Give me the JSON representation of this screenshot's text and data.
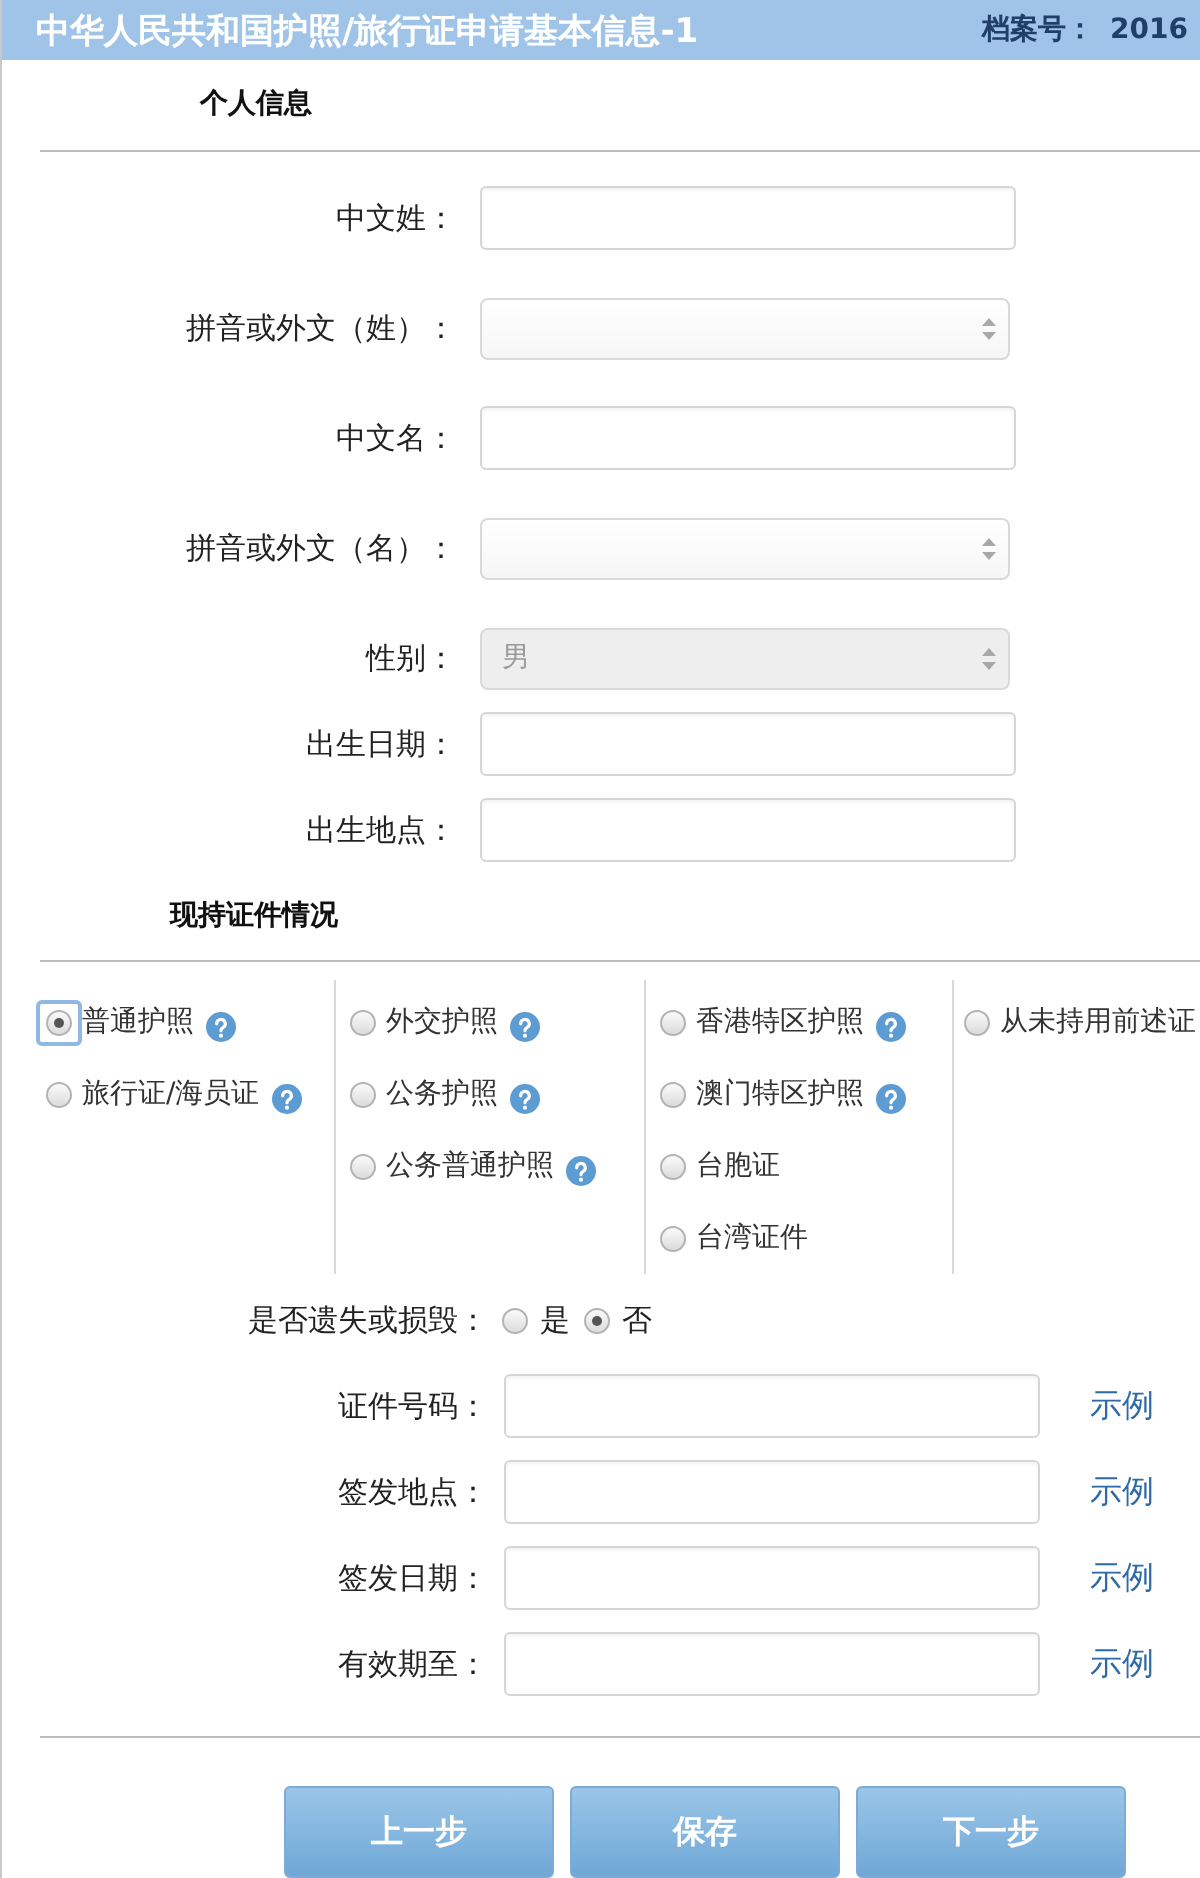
{
  "header": {
    "title": "中华人民共和国护照/旅行证申请基本信息-1",
    "file_number_label": "档案号：",
    "file_number": "2016"
  },
  "personal_info": {
    "heading": "个人信息",
    "fields": [
      {
        "kind": "input",
        "label": "中文姓：",
        "disabled": false
      },
      {
        "kind": "select",
        "label": "拼音或外文（姓）：",
        "disabled": false
      },
      {
        "kind": "input",
        "label": "中文名：",
        "disabled": false
      },
      {
        "kind": "select",
        "label": "拼音或外文（名）：",
        "disabled": false
      },
      {
        "kind": "select",
        "label": "性别：",
        "value": "男",
        "disabled": true
      },
      {
        "kind": "input",
        "label": "出生日期：",
        "disabled": false
      },
      {
        "kind": "input",
        "label": "出生地点：",
        "disabled": false
      }
    ]
  },
  "current_documents": {
    "heading": "现持证件情况",
    "columns": [
      {
        "options": [
          {
            "label": "普通护照",
            "selected": true,
            "focused": true,
            "help": true
          },
          {
            "label": "旅行证/海员证",
            "selected": false,
            "focused": false,
            "help": true
          }
        ]
      },
      {
        "options": [
          {
            "label": "外交护照",
            "selected": false,
            "focused": false,
            "help": true
          },
          {
            "label": "公务护照",
            "selected": false,
            "focused": false,
            "help": true
          },
          {
            "label": "公务普通护照",
            "selected": false,
            "focused": false,
            "help": true
          }
        ]
      },
      {
        "options": [
          {
            "label": "香港特区护照",
            "selected": false,
            "focused": false,
            "help": true
          },
          {
            "label": "澳门特区护照",
            "selected": false,
            "focused": false,
            "help": true
          },
          {
            "label": "台胞证",
            "selected": false,
            "focused": false,
            "help": false
          },
          {
            "label": "台湾证件",
            "selected": false,
            "focused": false,
            "help": false
          }
        ]
      },
      {
        "options": [
          {
            "label": "从未持用前述证",
            "selected": false,
            "focused": false,
            "help": false
          }
        ]
      }
    ]
  },
  "lost_or_damaged": {
    "label": "是否遗失或损毁：",
    "options": [
      {
        "label": "是",
        "selected": false
      },
      {
        "label": "否",
        "selected": true
      }
    ]
  },
  "document_fields": [
    {
      "label": "证件号码：",
      "link": "示例"
    },
    {
      "label": "签发地点：",
      "link": "示例"
    },
    {
      "label": "签发日期：",
      "link": "示例"
    },
    {
      "label": "有效期至：",
      "link": "示例"
    }
  ],
  "buttons": [
    "上一步",
    "保存",
    "下一步"
  ]
}
